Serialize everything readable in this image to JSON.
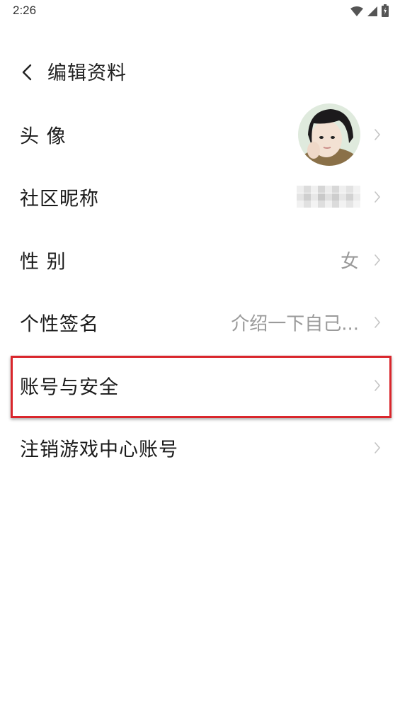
{
  "status_bar": {
    "time": "2:26",
    "icons": [
      "wifi-icon",
      "signal-icon",
      "battery-icon"
    ]
  },
  "header": {
    "back_icon": "chevron-left-icon",
    "title": "编辑资料"
  },
  "rows": [
    {
      "label": "头 像",
      "value": "",
      "type": "avatar"
    },
    {
      "label": "社区昵称",
      "value": "",
      "type": "blurred"
    },
    {
      "label": "性 别",
      "value": "女",
      "type": "text"
    },
    {
      "label": "个性签名",
      "value": "介绍一下自己...",
      "type": "text"
    },
    {
      "label": "账号与安全",
      "value": "",
      "type": "none"
    },
    {
      "label": "注销游戏中心账号",
      "value": "",
      "type": "none"
    }
  ],
  "highlight_color": "#d9262c",
  "chevron_color": "#c4c4c4"
}
